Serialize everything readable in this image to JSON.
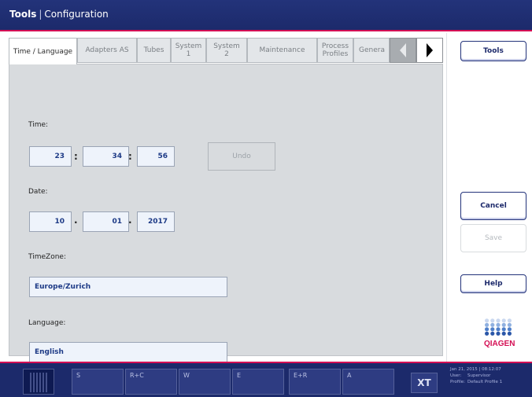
{
  "window": {
    "title_bold": "Tools",
    "title_sep": "|",
    "title_rest": "Configuration"
  },
  "tabs": [
    {
      "label": "Time / Language",
      "active": true
    },
    {
      "label": "Adapters AS",
      "active": false
    },
    {
      "label": "Tubes",
      "active": false
    },
    {
      "label": "System\n1",
      "active": false
    },
    {
      "label": "System\n2",
      "active": false
    },
    {
      "label": "Maintenance",
      "active": false
    },
    {
      "label": "Process\nProfiles",
      "active": false
    },
    {
      "label": "Genera",
      "active": false
    }
  ],
  "form": {
    "time_label": "Time:",
    "time_hours": "23",
    "time_minutes": "34",
    "time_seconds": "56",
    "time_separator": ":",
    "undo_label": "Undo",
    "date_label": "Date:",
    "date_day": "10",
    "date_month": "01",
    "date_year": "2017",
    "date_separator": ".",
    "timezone_label": "TimeZone:",
    "timezone_value": "Europe/Zurich",
    "language_label": "Language:",
    "language_value": "English"
  },
  "side": {
    "tools_label": "Tools",
    "cancel_label": "Cancel",
    "save_label": "Save",
    "help_label": "Help",
    "logo_text": "QIAGEN"
  },
  "bottom": {
    "buttons": [
      {
        "label": "S"
      },
      {
        "label": "R+C"
      },
      {
        "label": "W"
      },
      {
        "label": "E"
      },
      {
        "label": "E+R"
      },
      {
        "label": "A"
      }
    ],
    "tools_glyph": "XT",
    "status_datetime": "Jan 21, 2015 | 08:12:07",
    "status_user_key": "User:",
    "status_user_value": "Supervisor",
    "status_profile_key": "Profile:",
    "status_profile_value": "Default Profile 1"
  },
  "colors": {
    "header_bg": "#1c2a6b",
    "accent_line": "#d40f54",
    "field_text": "#1d3a86",
    "logo_red": "#d40f54",
    "logo_blue": "#2b57a8"
  }
}
